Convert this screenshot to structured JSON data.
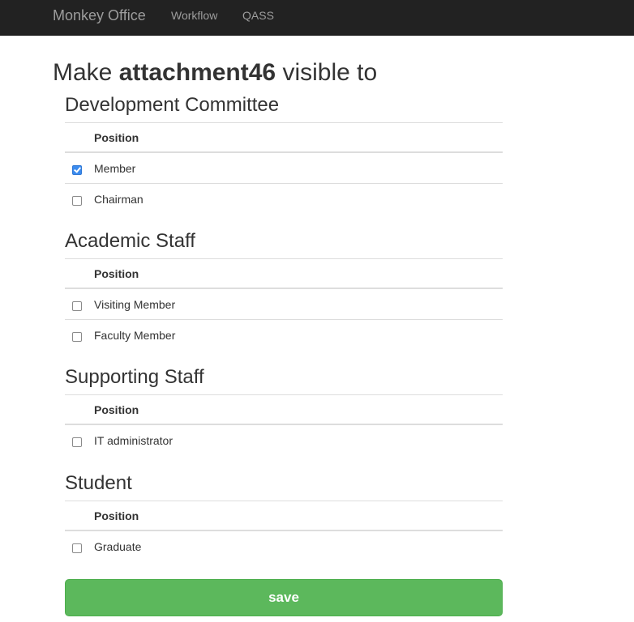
{
  "navbar": {
    "brand": "Monkey Office",
    "links": [
      "Workflow",
      "QASS"
    ]
  },
  "page": {
    "title_prefix": "Make ",
    "attachment_name": "attachment46",
    "title_suffix": " visible to"
  },
  "groups": [
    {
      "name": "Development Committee",
      "column_header": "Position",
      "rows": [
        {
          "label": "Member",
          "checked": true
        },
        {
          "label": "Chairman",
          "checked": false
        }
      ]
    },
    {
      "name": "Academic Staff",
      "column_header": "Position",
      "rows": [
        {
          "label": "Visiting Member",
          "checked": false
        },
        {
          "label": "Faculty Member",
          "checked": false
        }
      ]
    },
    {
      "name": "Supporting Staff",
      "column_header": "Position",
      "rows": [
        {
          "label": "IT administrator",
          "checked": false
        }
      ]
    },
    {
      "name": "Student",
      "column_header": "Position",
      "rows": [
        {
          "label": "Graduate",
          "checked": false
        }
      ]
    }
  ],
  "save_label": "save",
  "colors": {
    "navbar_bg": "#222222",
    "nav_text": "#9d9d9d",
    "checkbox_checked": "#3b8bee",
    "save_button": "#5cb85c"
  }
}
